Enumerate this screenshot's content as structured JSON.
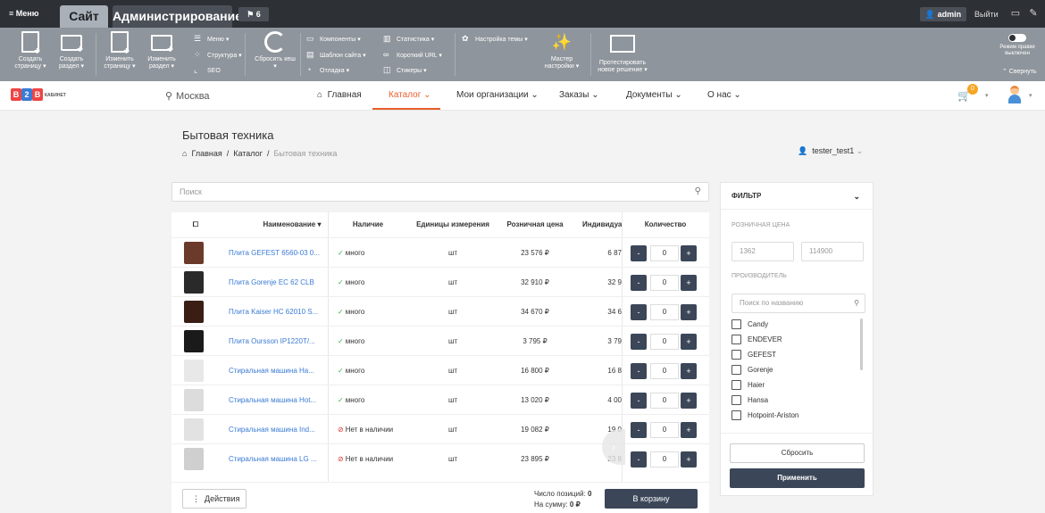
{
  "topbar": {
    "menu": "≡ Меню",
    "tab_site": "Сайт",
    "tab_admin": "Администрирование",
    "notifications": "6",
    "user": "admin",
    "logout": "Выйти"
  },
  "toolbar": {
    "create_page": "Создать страницу ▾",
    "create_section": "Создать раздел ▾",
    "edit_page": "Изменить страницу ▾",
    "edit_section": "Изменить раздел ▾",
    "menu": "Меню ▾",
    "structure": "Структура ▾",
    "seo": "SEO",
    "reset_cache": "Сбросить кеш ▾",
    "components": "Компоненты ▾",
    "site_template": "Шаблон сайта ▾",
    "debug": "Отладка ▾",
    "statistics": "Статистика ▾",
    "short_url": "Короткий URL ▾",
    "stickers": "Стикеры ▾",
    "theme_settings": "Настройка темы ▾",
    "settings_wizard": "Мастер настройки ▾",
    "test_solution": "Протестировать новое решение ▾",
    "edit_mode": "Режим правки выключен",
    "collapse": "⌃ Свернуть"
  },
  "nav": {
    "logo_b": "B",
    "logo_2": "2",
    "logo_b2": "B",
    "logo_cabinet": "КАБИНЕТ",
    "city": "Москва",
    "home": "Главная",
    "catalog": "Каталог",
    "orgs": "Мои организации",
    "orders": "Заказы",
    "docs": "Документы",
    "about": "О нас",
    "cart_count": "0"
  },
  "page": {
    "title": "Бытовая техника",
    "crumb_home": "Главная",
    "crumb_catalog": "Каталог",
    "crumb_current": "Бытовая техника",
    "user": "tester_test1",
    "search_placeholder": "Поиск"
  },
  "table": {
    "headers": {
      "name": "Наименование ▾",
      "stock": "Наличие",
      "units": "Единицы измерения",
      "retail": "Розничная цена",
      "individual": "Индивидуа",
      "qty": "Количество"
    },
    "rows": [
      {
        "name": "Плита GEFEST 6560-03 0...",
        "stock": "много",
        "in": true,
        "unit": "шт",
        "price": "23 576 ₽",
        "ind": "6 87",
        "qty": "0",
        "color": "#6b3a2a"
      },
      {
        "name": "Плита Gorenje EC 62 CLB",
        "stock": "много",
        "in": true,
        "unit": "шт",
        "price": "32 910 ₽",
        "ind": "32 9",
        "qty": "0",
        "color": "#2a2a2a"
      },
      {
        "name": "Плита Kaiser HC 62010 S...",
        "stock": "много",
        "in": true,
        "unit": "шт",
        "price": "34 670 ₽",
        "ind": "34 6",
        "qty": "0",
        "color": "#3a1e14"
      },
      {
        "name": "Плита Oursson IP1220T/...",
        "stock": "много",
        "in": true,
        "unit": "шт",
        "price": "3 795 ₽",
        "ind": "3 79",
        "qty": "0",
        "color": "#1a1a1a"
      },
      {
        "name": "Стиральная машина Ha...",
        "stock": "много",
        "in": true,
        "unit": "шт",
        "price": "16 800 ₽",
        "ind": "16 8",
        "qty": "0",
        "color": "#e8e8e8"
      },
      {
        "name": "Стиральная машина Hot...",
        "stock": "много",
        "in": true,
        "unit": "шт",
        "price": "13 020 ₽",
        "ind": "4 00",
        "qty": "0",
        "color": "#dcdcdc"
      },
      {
        "name": "Стиральная машина Ind...",
        "stock": "Нет в наличии",
        "in": false,
        "unit": "шт",
        "price": "19 082 ₽",
        "ind": "19 0",
        "qty": "0",
        "color": "#e2e2e2"
      },
      {
        "name": "Стиральная машина LG ...",
        "stock": "Нет в наличии",
        "in": false,
        "unit": "шт",
        "price": "23 895 ₽",
        "ind": "23 8",
        "qty": "0",
        "color": "#cfcfcf"
      }
    ]
  },
  "bottom": {
    "actions": "Действия",
    "positions": "Число позиций:",
    "positions_val": "0",
    "sum": "На сумму:",
    "sum_val": "0 ₽",
    "to_cart": "В корзину"
  },
  "filter": {
    "title": "ФИЛЬТР",
    "retail_label": "РОЗНИЧНАЯ ЦЕНА",
    "min": "1362",
    "max": "114900",
    "maker_label": "ПРОИЗВОДИТЕЛЬ",
    "search_placeholder": "Поиск по названию",
    "brands": [
      "Candy",
      "ENDEVER",
      "GEFEST",
      "Gorenje",
      "Haier",
      "Hansa",
      "Hotpoint-Ariston"
    ],
    "reset": "Сбросить",
    "apply": "Применить"
  }
}
